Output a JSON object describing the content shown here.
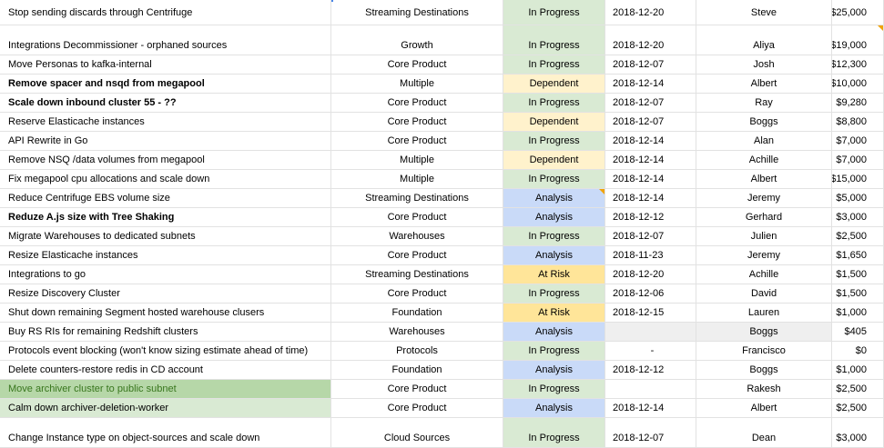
{
  "rows": [
    {
      "task": "Stop sending discards through Centrifuge",
      "team": "Streaming Destinations",
      "status": "In Progress",
      "status_key": "inprogress",
      "date": "2018-12-20",
      "owner": "Steve",
      "cost": "$25,000",
      "bold": false
    },
    {
      "task": "Integrations Decommissioner - orphaned sources",
      "team": "Growth",
      "status": "In Progress",
      "status_key": "inprogress",
      "date": "2018-12-20",
      "owner": "Aliya",
      "cost": "$19,000",
      "bold": false
    },
    {
      "task": "Move Personas to kafka-internal",
      "team": "Core Product",
      "status": "In Progress",
      "status_key": "inprogress",
      "date": "2018-12-07",
      "owner": "Josh",
      "cost": "$12,300",
      "bold": false
    },
    {
      "task": "Remove spacer and nsqd from megapool",
      "team": "Multiple",
      "status": "Dependent",
      "status_key": "dependent",
      "date": "2018-12-14",
      "owner": "Albert",
      "cost": "$10,000",
      "bold": true
    },
    {
      "task": "Scale down inbound cluster 55 - ??",
      "team": "Core Product",
      "status": "In Progress",
      "status_key": "inprogress",
      "date": "2018-12-07",
      "owner": "Ray",
      "cost": "$9,280",
      "bold": true
    },
    {
      "task": "Reserve Elasticache instances",
      "team": "Core Product",
      "status": "Dependent",
      "status_key": "dependent",
      "date": "2018-12-07",
      "owner": "Boggs",
      "cost": "$8,800",
      "bold": false
    },
    {
      "task": "API Rewrite in Go",
      "team": "Core Product",
      "status": "In Progress",
      "status_key": "inprogress",
      "date": "2018-12-14",
      "owner": "Alan",
      "cost": "$7,000",
      "bold": false
    },
    {
      "task": "Remove NSQ /data volumes from megapool",
      "team": "Multiple",
      "status": "Dependent",
      "status_key": "dependent",
      "date": "2018-12-14",
      "owner": "Achille",
      "cost": "$7,000",
      "bold": false
    },
    {
      "task": "Fix megapool cpu allocations and scale down",
      "team": "Multiple",
      "status": "In Progress",
      "status_key": "inprogress",
      "date": "2018-12-14",
      "owner": "Albert",
      "cost": "$15,000",
      "bold": false
    },
    {
      "task": "Reduce Centrifuge EBS volume size",
      "team": "Streaming Destinations",
      "status": "Analysis",
      "status_key": "analysis",
      "date": "2018-12-14",
      "owner": "Jeremy",
      "cost": "$5,000",
      "bold": false
    },
    {
      "task": "Reduze A.js size with Tree Shaking",
      "team": "Core Product",
      "status": "Analysis",
      "status_key": "analysis",
      "date": "2018-12-12",
      "owner": "Gerhard",
      "cost": "$3,000",
      "bold": true
    },
    {
      "task": "Migrate Warehouses to dedicated subnets",
      "team": "Warehouses",
      "status": "In Progress",
      "status_key": "inprogress",
      "date": "2018-12-07",
      "owner": "Julien",
      "cost": "$2,500",
      "bold": false
    },
    {
      "task": "Resize Elasticache instances",
      "team": "Core Product",
      "status": "Analysis",
      "status_key": "analysis",
      "date": "2018-11-23",
      "owner": "Jeremy",
      "cost": "$1,650",
      "bold": false
    },
    {
      "task": "Integrations to go",
      "team": "Streaming Destinations",
      "status": "At Risk",
      "status_key": "atrisk",
      "date": "2018-12-20",
      "owner": "Achille",
      "cost": "$1,500",
      "bold": false
    },
    {
      "task": "Resize Discovery Cluster",
      "team": "Core Product",
      "status": "In Progress",
      "status_key": "inprogress",
      "date": "2018-12-06",
      "owner": "David",
      "cost": "$1,500",
      "bold": false
    },
    {
      "task": "Shut down remaining Segment hosted warehouse clusers",
      "team": "Foundation",
      "status": "At Risk",
      "status_key": "atrisk",
      "date": "2018-12-15",
      "owner": "Lauren",
      "cost": "$1,000",
      "bold": false
    },
    {
      "task": "Buy RS RIs for remaining Redshift clusters",
      "team": "Warehouses",
      "status": "Analysis",
      "status_key": "analysis",
      "date": "",
      "owner": "Boggs",
      "cost": "$405",
      "bold": false
    },
    {
      "task": "Protocols event blocking (won't know sizing estimate ahead of time)",
      "team": "Protocols",
      "status": "In Progress",
      "status_key": "inprogress",
      "date": "-",
      "owner": "Francisco",
      "cost": "$0",
      "bold": false
    },
    {
      "task": "Delete counters-restore redis in CD account",
      "team": "Foundation",
      "status": "Analysis",
      "status_key": "analysis",
      "date": "2018-12-12",
      "owner": "Boggs",
      "cost": "$1,000",
      "bold": false
    },
    {
      "task": "Move archiver cluster to public subnet",
      "team": "Core Product",
      "status": "In Progress",
      "status_key": "inprogress",
      "date": "",
      "owner": "Rakesh",
      "cost": "$2,500",
      "bold": false
    },
    {
      "task": "Calm down archiver-deletion-worker",
      "team": "Core Product",
      "status": "Analysis",
      "status_key": "analysis",
      "date": "2018-12-14",
      "owner": "Albert",
      "cost": "$2,500",
      "bold": false
    },
    {
      "task": "Change Instance type on object-sources and scale down",
      "team": "Cloud Sources",
      "status": "In Progress",
      "status_key": "inprogress",
      "date": "2018-12-07",
      "owner": "Dean",
      "cost": "$3,000",
      "bold": false
    }
  ],
  "colors": {
    "in_progress": "#d9ead3",
    "dependent": "#fff2cc",
    "analysis": "#c9daf8",
    "at_risk": "#ffe599",
    "highlight_green": "#b6d7a8",
    "note_marker": "#f0a30a"
  }
}
